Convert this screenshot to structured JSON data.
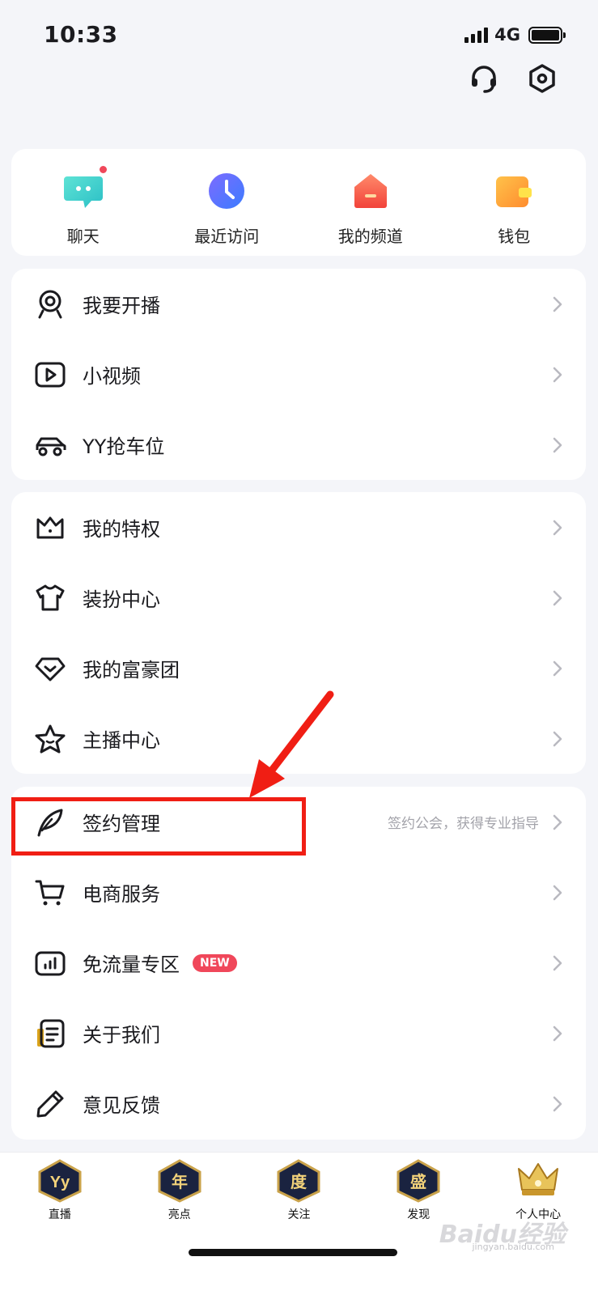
{
  "status_bar": {
    "time": "10:33",
    "network": "4G"
  },
  "quick_actions": [
    {
      "label": "聊天",
      "icon": "chat-icon",
      "has_dot": true
    },
    {
      "label": "最近访问",
      "icon": "clock-icon"
    },
    {
      "label": "我的频道",
      "icon": "channel-icon"
    },
    {
      "label": "钱包",
      "icon": "wallet-icon"
    }
  ],
  "group1": [
    {
      "label": "我要开播",
      "icon": "webcam-icon"
    },
    {
      "label": "小视频",
      "icon": "video-play-icon"
    },
    {
      "label": "YY抢车位",
      "icon": "car-icon"
    }
  ],
  "group2": [
    {
      "label": "我的特权",
      "icon": "crown-icon"
    },
    {
      "label": "装扮中心",
      "icon": "tshirt-icon"
    },
    {
      "label": "我的富豪团",
      "icon": "diamond-icon"
    },
    {
      "label": "主播中心",
      "icon": "star-icon"
    }
  ],
  "group3": [
    {
      "label": "签约管理",
      "icon": "feather-icon",
      "hint": "签约公会，获得专业指导"
    },
    {
      "label": "电商服务",
      "icon": "cart-icon"
    },
    {
      "label": "免流量专区",
      "icon": "data-chart-icon",
      "badge": "NEW"
    },
    {
      "label": "关于我们",
      "icon": "document-icon"
    },
    {
      "label": "意见反馈",
      "icon": "pencil-icon"
    }
  ],
  "tabs": [
    {
      "label": "直播",
      "glyph": "Yy"
    },
    {
      "label": "亮点",
      "glyph": "年"
    },
    {
      "label": "关注",
      "glyph": "度"
    },
    {
      "label": "发现",
      "glyph": "盛"
    },
    {
      "label": "个人中心",
      "glyph": ""
    }
  ],
  "watermark": {
    "text": "Baidu经验",
    "sub": "jingyan.baidu.com"
  },
  "colors": {
    "accent_red": "#f0475a",
    "annotation_red": "#f01e14",
    "background": "#f4f5f9"
  }
}
